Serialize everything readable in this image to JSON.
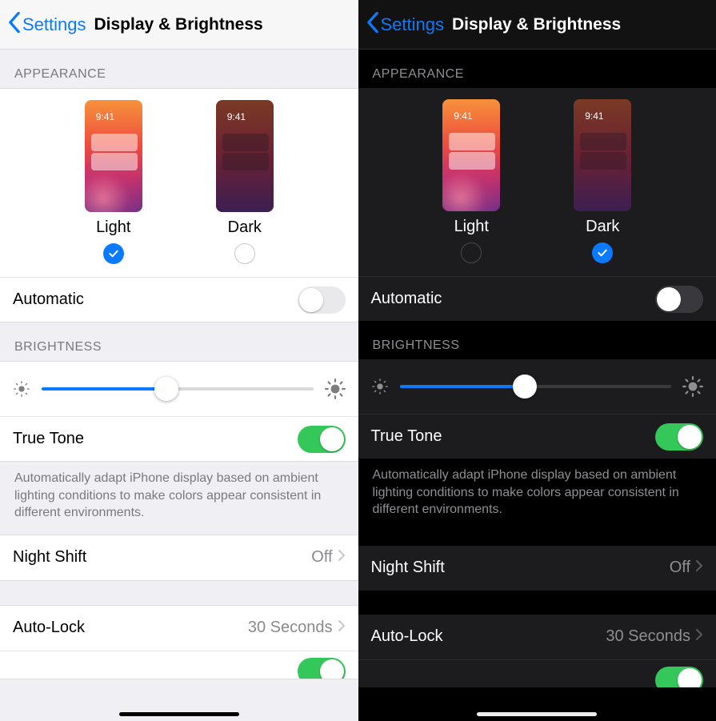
{
  "panes": [
    {
      "mode": "light",
      "brightness_pct": 46
    },
    {
      "mode": "dark",
      "brightness_pct": 46
    }
  ],
  "nav": {
    "back_label": "Settings",
    "title": "Display & Brightness"
  },
  "appearance": {
    "header": "APPEARANCE",
    "options": [
      {
        "label": "Light",
        "clock": "9:41"
      },
      {
        "label": "Dark",
        "clock": "9:41"
      }
    ],
    "automatic_label": "Automatic",
    "automatic_on": false
  },
  "brightness": {
    "header": "BRIGHTNESS",
    "true_tone_label": "True Tone",
    "true_tone_on": true,
    "true_tone_desc": "Automatically adapt iPhone display based on ambient lighting conditions to make colors appear consistent in different environments."
  },
  "night_shift": {
    "label": "Night Shift",
    "value": "Off"
  },
  "auto_lock": {
    "label": "Auto-Lock",
    "value": "30 Seconds"
  }
}
